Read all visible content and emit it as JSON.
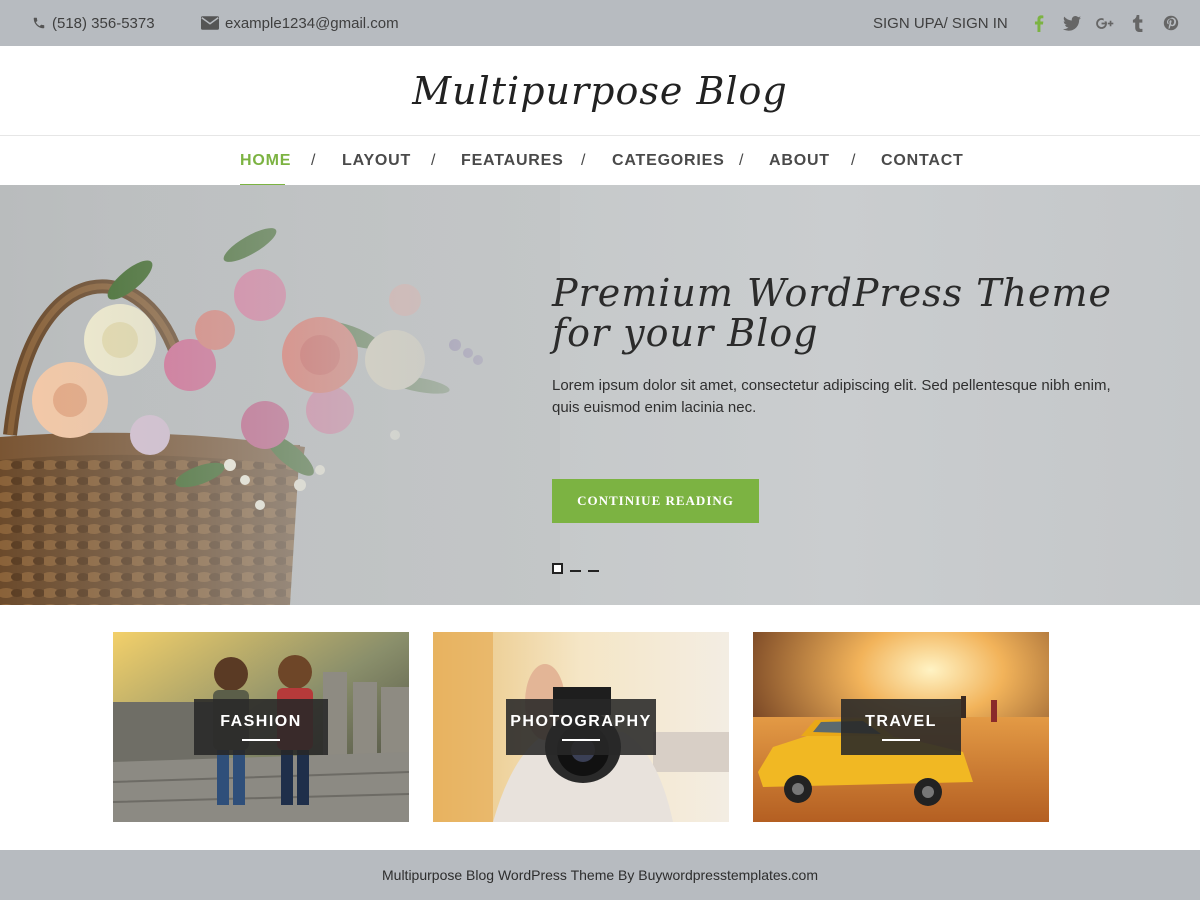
{
  "topbar": {
    "phone": "(518) 356-5373",
    "email": "example1234@gmail.com",
    "signin": "SIGN UPA/ SIGN IN",
    "socials": [
      "facebook-icon",
      "twitter-icon",
      "google-plus-icon",
      "tumblr-icon",
      "pinterest-icon"
    ],
    "social_color": "#7cb342"
  },
  "logo": {
    "text": "Multipurpose Blog"
  },
  "nav": {
    "items": [
      "HOME",
      "LAYOUT",
      "FEATAURES",
      "CATEGORIES",
      "ABOUT",
      "CONTACT"
    ],
    "separator": "/",
    "active": "HOME"
  },
  "hero": {
    "title": "Premium WordPress Theme for your Blog",
    "description": "Lorem ipsum dolor sit amet, consectetur adipiscing elit. Sed pellentesque nibh enim, quis euismod enim lacinia nec.",
    "button": "CONTINIUE READING",
    "slides": 3,
    "active_slide": 1
  },
  "categories": [
    {
      "label": "FASHION"
    },
    {
      "label": "PHOTOGRAPHY"
    },
    {
      "label": "TRAVEL"
    }
  ],
  "footer": {
    "text": "Multipurpose Blog WordPress Theme By Buywordpresstemplates.com"
  },
  "colors": {
    "accent": "#7cb342",
    "topbar": "#b7bbc0",
    "footer": "#b7bbc0"
  }
}
